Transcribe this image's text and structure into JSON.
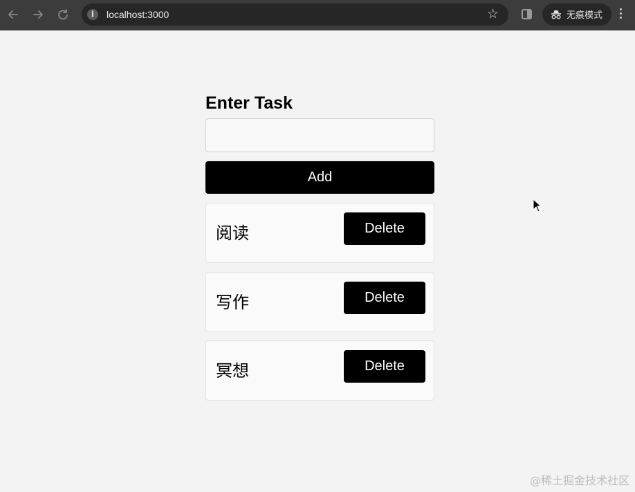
{
  "browser": {
    "back_icon": "arrow-left-icon",
    "forward_icon": "arrow-right-icon",
    "reload_icon": "reload-icon",
    "url": "localhost:3000",
    "bookmark_icon": "star-icon",
    "incognito_label": "无痕模式"
  },
  "app": {
    "heading": "Enter Task",
    "input_value": "",
    "add_label": "Add",
    "tasks": [
      {
        "label": "阅读",
        "delete_label": "Delete"
      },
      {
        "label": "写作",
        "delete_label": "Delete"
      },
      {
        "label": "冥想",
        "delete_label": "Delete"
      }
    ]
  },
  "watermark": "@稀土掘金技术社区"
}
